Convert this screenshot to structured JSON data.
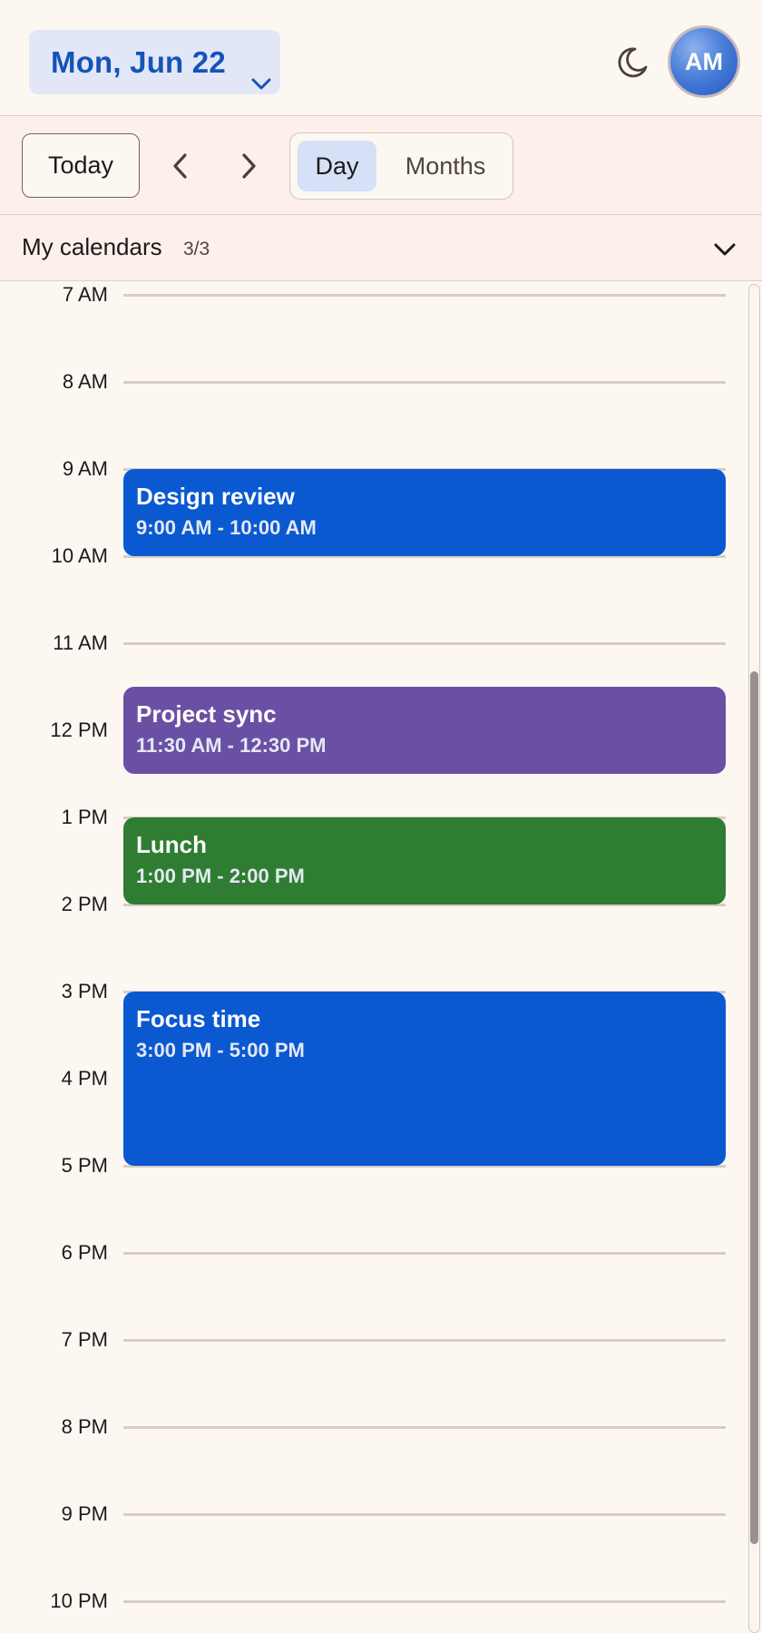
{
  "header": {
    "date_label": "Mon, Jun 22",
    "avatar_initials": "AM",
    "theme_icon": "moon-icon",
    "dropdown_icon": "chevron-down-icon"
  },
  "toolbar": {
    "today_label": "Today",
    "prev_icon": "chevron-left-icon",
    "next_icon": "chevron-right-icon",
    "views": [
      {
        "label": "Day",
        "selected": true
      },
      {
        "label": "Months",
        "selected": false
      }
    ]
  },
  "calendars": {
    "label": "My calendars",
    "count": "3/3",
    "expand_icon": "chevron-down-icon"
  },
  "timeline": {
    "hours": [
      "7 AM",
      "8 AM",
      "9 AM",
      "10 AM",
      "11 AM",
      "12 PM",
      "1 PM",
      "2 PM",
      "3 PM",
      "4 PM",
      "5 PM",
      "6 PM",
      "7 PM",
      "8 PM",
      "9 PM",
      "10 PM"
    ],
    "events": [
      {
        "title": "Design review",
        "time": "9:00 AM - 10:00 AM",
        "color": "#0a59d1"
      },
      {
        "title": "Project sync",
        "time": "11:30 AM - 12:30 PM",
        "color": "#6a50a4"
      },
      {
        "title": "Lunch",
        "time": "1:00 PM - 2:00 PM",
        "color": "#2f7d32"
      },
      {
        "title": "Focus time",
        "time": "3:00 PM - 5:00 PM",
        "color": "#0a59d1"
      }
    ]
  },
  "colors": {
    "accent": "#1553b8",
    "background": "#fdf7f2",
    "toolbar_bg": "#fdf0ea",
    "selected_view_bg": "#d6e0f7"
  }
}
